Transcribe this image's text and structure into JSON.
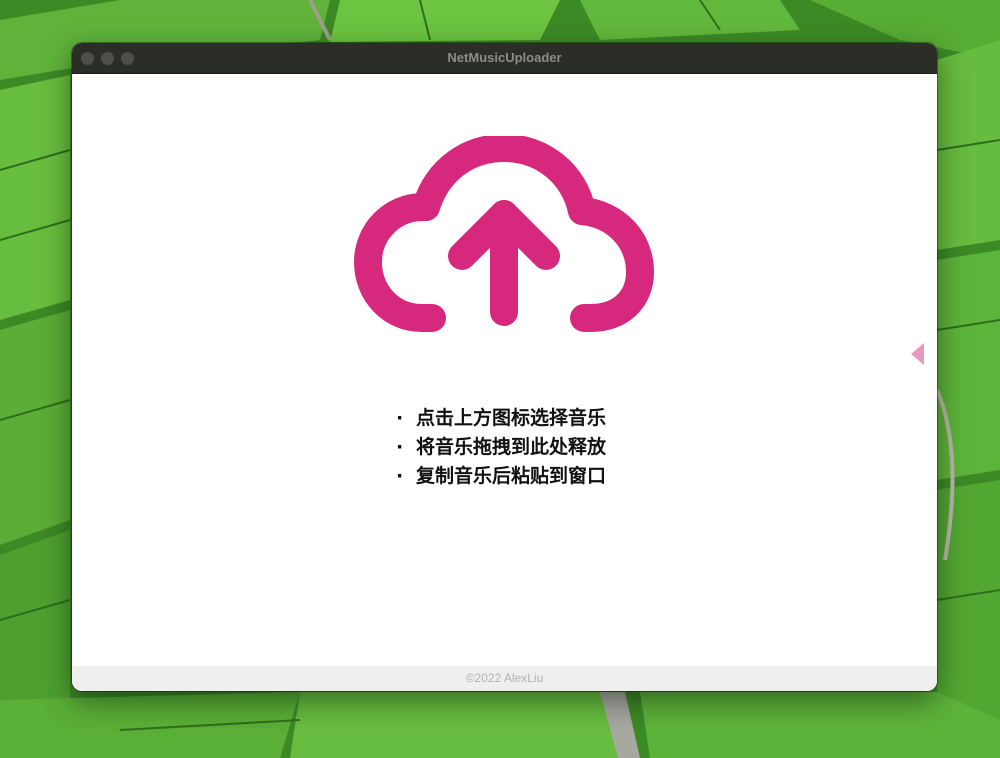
{
  "window": {
    "title": "NetMusicUploader"
  },
  "upload": {
    "icon": "cloud-upload-icon",
    "color": "#D6297D"
  },
  "instructions": [
    {
      "bullet": "·",
      "text": "点击上方图标选择音乐"
    },
    {
      "bullet": "·",
      "text": "将音乐拖拽到此处释放"
    },
    {
      "bullet": "·",
      "text": "复制音乐后粘贴到窗口"
    }
  ],
  "footer": {
    "copyright": "©2022 AlexLiu"
  },
  "side_panel": {
    "icon": "triangle-left-icon",
    "color": "#E79ABF"
  }
}
